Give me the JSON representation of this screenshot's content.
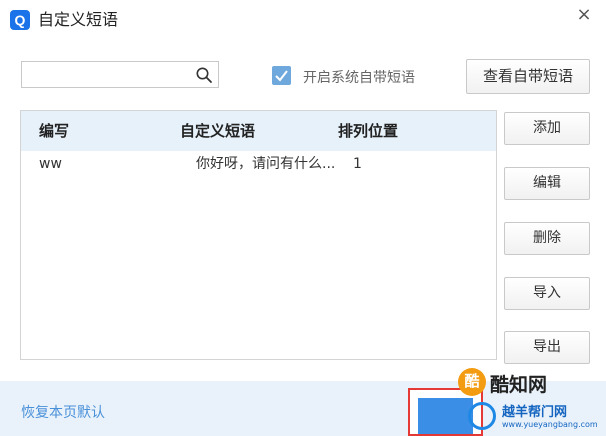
{
  "window": {
    "app_icon": "Q",
    "title": "自定义短语",
    "close_label": "×"
  },
  "search": {
    "value": "",
    "placeholder": "",
    "icon": "search-icon"
  },
  "system_phrases_checkbox": {
    "checked": true,
    "label": "开启系统自带短语"
  },
  "view_builtin_button": "查看自带短语",
  "table": {
    "columns": [
      "编写",
      "自定义短语",
      "排列位置"
    ],
    "rows": [
      {
        "abbr": "ww",
        "phrase": "你好呀，请问有什么...",
        "position": "1"
      }
    ]
  },
  "side_buttons": {
    "add": "添加",
    "edit": "编辑",
    "delete": "删除",
    "import": "导入",
    "export": "导出"
  },
  "footer": {
    "restore_default": "恢复本页默认"
  },
  "watermark": {
    "badge": "酷",
    "brand": "酷知网",
    "site": "越羊帮门网",
    "url": "www.yueyangbang.com"
  },
  "colors": {
    "accent": "#1a73e8",
    "header_bg": "#e6f1fa",
    "footer_bg": "#e9f2fb",
    "link": "#4a90d9",
    "checkbox": "#6fa8dc"
  }
}
